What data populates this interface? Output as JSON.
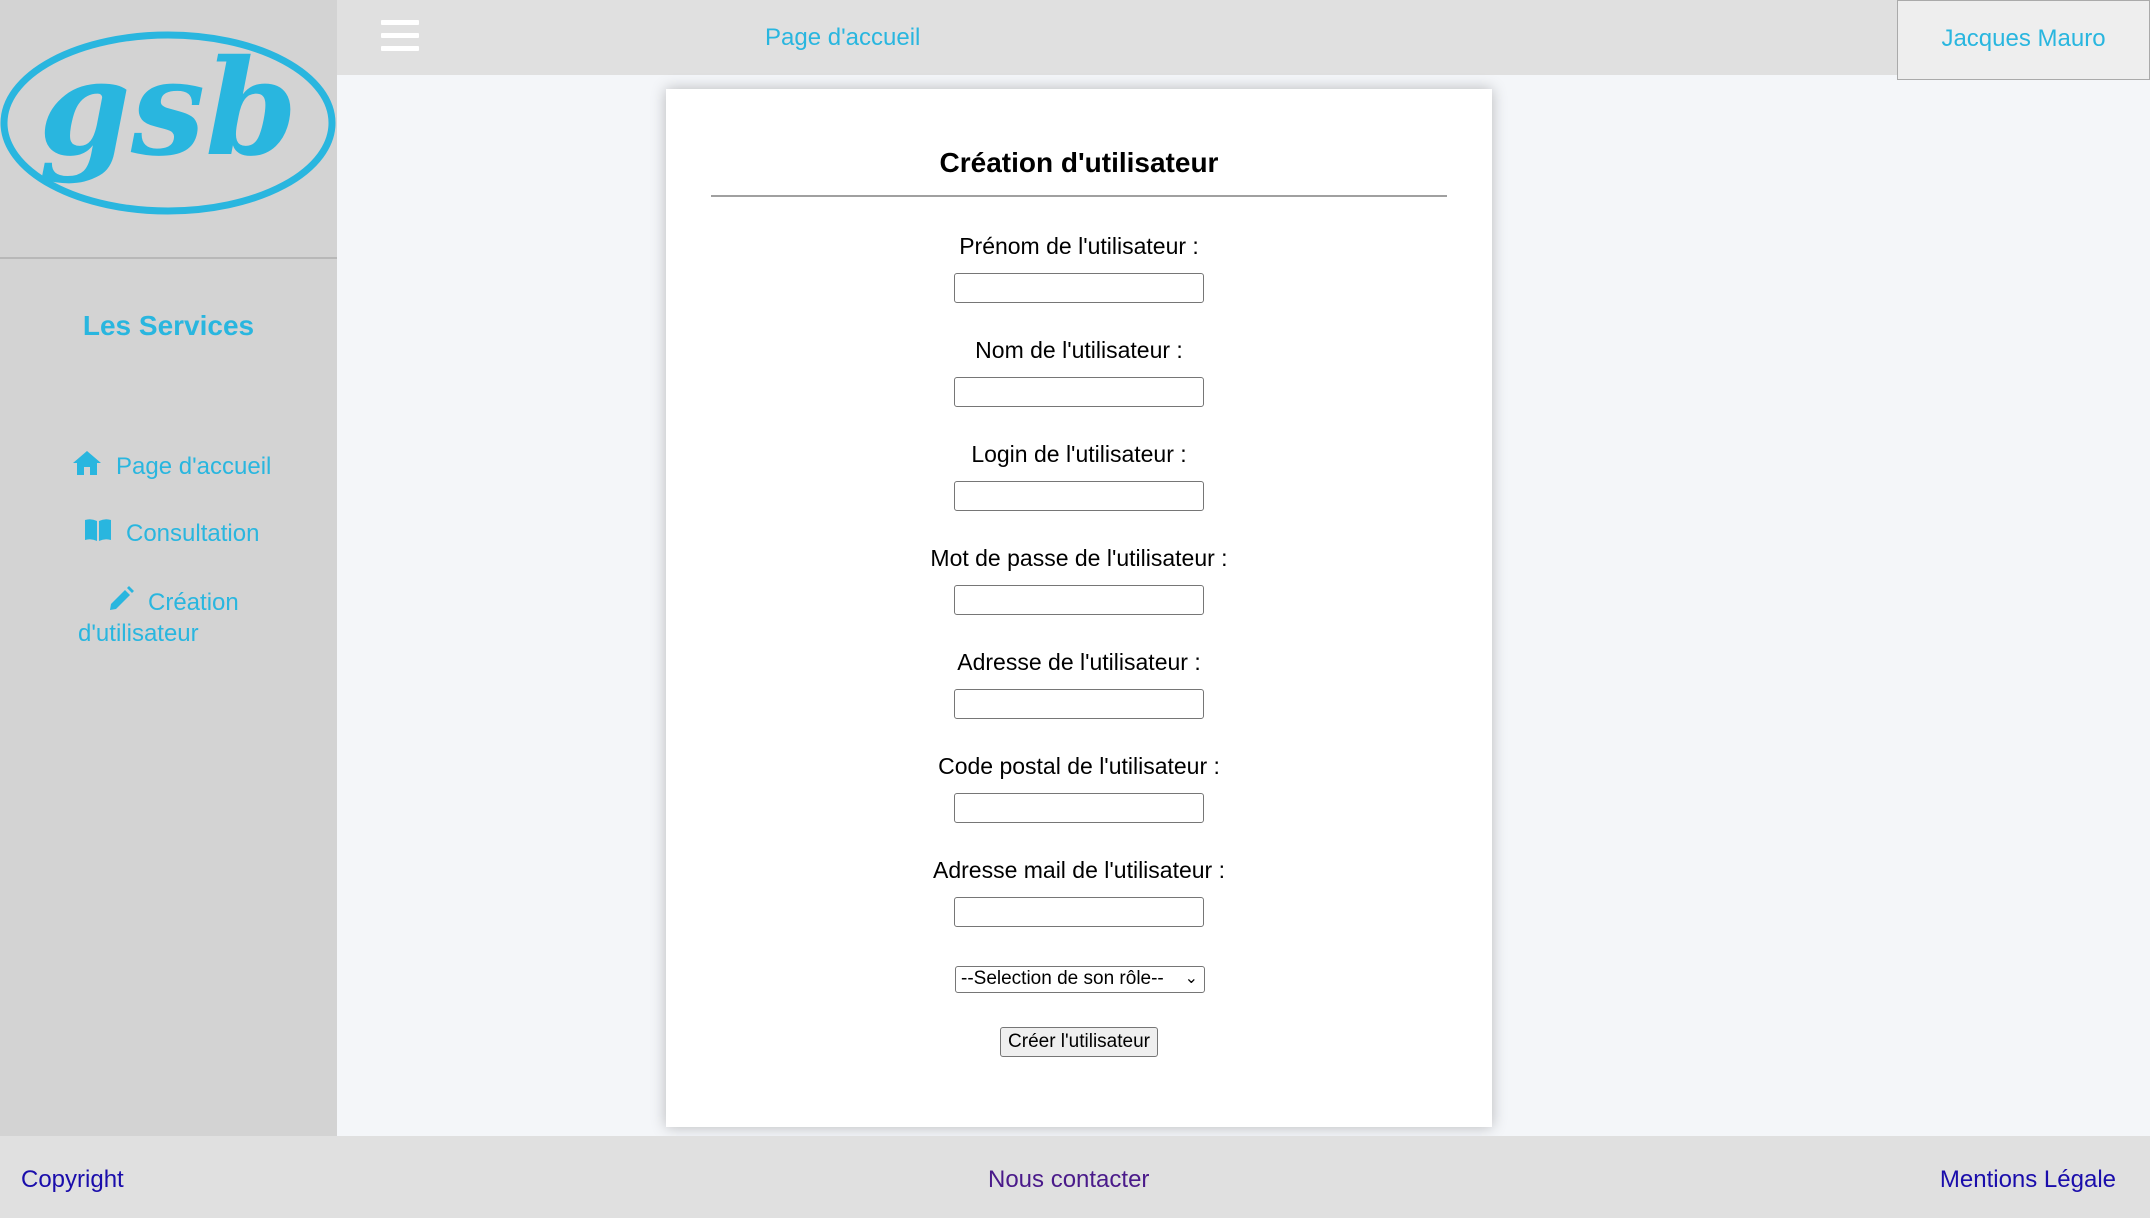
{
  "sidebar": {
    "logo_text": "gsb",
    "title": "Les Services",
    "items": [
      {
        "label": "Page d'accueil",
        "icon": "home-icon"
      },
      {
        "label": "Consultation",
        "icon": "book-open-icon"
      },
      {
        "label_line1": "Création",
        "label_line2": "d'utilisateur",
        "icon": "pencil-icon"
      }
    ]
  },
  "header": {
    "menu_icon": "hamburger-icon",
    "home_link": "Page d'accueil",
    "user_name": "Jacques Mauro"
  },
  "form": {
    "title": "Création d'utilisateur",
    "fields": [
      {
        "label": "Prénom de l'utilisateur :",
        "value": ""
      },
      {
        "label": "Nom de l'utilisateur :",
        "value": ""
      },
      {
        "label": "Login de l'utilisateur :",
        "value": ""
      },
      {
        "label": "Mot de passe de l'utilisateur :",
        "value": ""
      },
      {
        "label": "Adresse de l'utilisateur :",
        "value": ""
      },
      {
        "label": "Code postal de l'utilisateur :",
        "value": ""
      },
      {
        "label": "Adresse mail de l'utilisateur :",
        "value": ""
      }
    ],
    "role_select": "--Selection de son rôle--",
    "submit_label": "Créer l'utilisateur"
  },
  "footer": {
    "copyright": "Copyright",
    "contact": "Nous contacter",
    "legal": "Mentions Légale"
  },
  "colors": {
    "accent": "#29b6df",
    "sidebar_bg": "#d3d3d3",
    "header_bg": "#e0e0e0",
    "content_bg": "#f4f6f9",
    "link_blue": "#1a0dab",
    "link_visited": "#4a1a8a"
  }
}
